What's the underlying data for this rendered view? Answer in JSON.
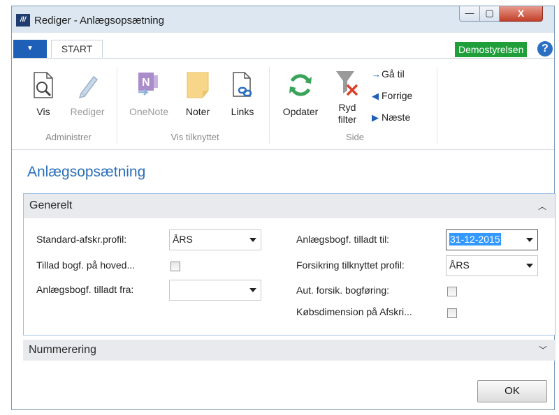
{
  "window": {
    "title": "Rediger - Anlægsopsætning",
    "close_glyph": "X"
  },
  "tabbar": {
    "active_tab": "START",
    "company": "Demostyrelsen",
    "help": "?"
  },
  "ribbon": {
    "buttons": {
      "vis": "Vis",
      "rediger": "Rediger",
      "onenote": "OneNote",
      "noter": "Noter",
      "links": "Links",
      "opdater": "Opdater",
      "ryd_filter_1": "Ryd",
      "ryd_filter_2": "filter"
    },
    "nav": {
      "ga_til": "Gå til",
      "forrige": "Forrige",
      "naeste": "Næste"
    },
    "groups": {
      "administrer": "Administrer",
      "vis_tilknyttet": "Vis tilknyttet",
      "side": "Side"
    }
  },
  "page": {
    "title": "Anlægsopsætning"
  },
  "generelt": {
    "title": "Generelt",
    "fields": {
      "standard_afskr_profil": {
        "label": "Standard-afskr.profil:",
        "value": "ÅRS"
      },
      "tillad_bogf_hoved": {
        "label": "Tillad bogf. på hoved...",
        "checked": false
      },
      "anlaegsbogf_fra": {
        "label": "Anlægsbogf. tilladt fra:",
        "value": ""
      },
      "anlaegsbogf_til": {
        "label": "Anlægsbogf. tilladt til:",
        "value": "31-12-2015"
      },
      "forsikring_profil": {
        "label": "Forsikring tilknyttet profil:",
        "value": "ÅRS"
      },
      "aut_forsik": {
        "label": "Aut. forsik. bogføring:",
        "checked": false
      },
      "kobsdimension": {
        "label": "Købsdimension på Afskri...",
        "checked": false
      }
    }
  },
  "nummerering": {
    "title": "Nummerering"
  },
  "footer": {
    "ok": "OK"
  }
}
